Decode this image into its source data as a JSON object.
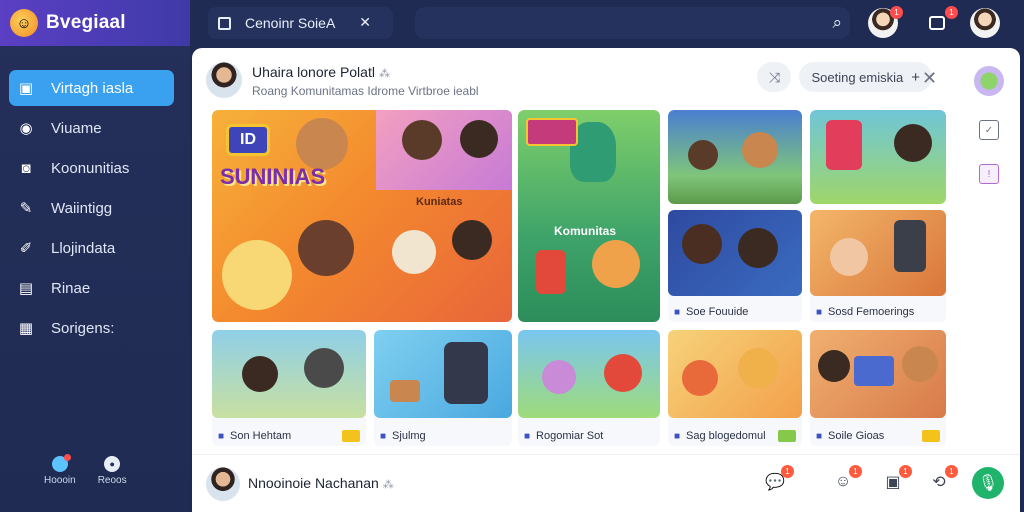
{
  "app": {
    "name": "Bvegiaal",
    "logo_icon": "smiley-logo-icon"
  },
  "sidebar": {
    "items": [
      {
        "label": "Virtagh iasla",
        "icon": "window-icon",
        "active": true
      },
      {
        "label": "Viuame",
        "icon": "chat-bubble-icon"
      },
      {
        "label": "Koonunitias",
        "icon": "camera-icon"
      },
      {
        "label": "Waiintigg",
        "icon": "pencil-icon"
      },
      {
        "label": "Llojindata",
        "icon": "pen-icon"
      },
      {
        "label": "Rinae",
        "icon": "folder-icon"
      },
      {
        "label": "Sorigens:",
        "icon": "grid-icon"
      }
    ],
    "footer": [
      {
        "label": "Hoooin"
      },
      {
        "label": "Reoos"
      }
    ]
  },
  "topbar": {
    "tab_label": "Cenoinr SoieA",
    "notifications_badge": "1",
    "messages_badge": "1"
  },
  "post": {
    "title": "Uhaira lonore Polatl",
    "title_suffix": "⁂",
    "subtitle": "Roang Komunitamas Idrome Virtbroe ieabl",
    "action_button": "Soeting emiskia",
    "plus": "+",
    "close": "✕"
  },
  "cards": {
    "hero_title_1": "SUNINIAS",
    "hero_badge": "ID",
    "hero_kuniatas": "Kuniatas",
    "green_title": "Komunitas",
    "captions": [
      "Soe Fouuide",
      "Sosd Femoerings",
      "Son Hehtam",
      "Sjulmg",
      "Rogomiar Sot",
      "Sag blogedomul",
      "Soile Gioas"
    ]
  },
  "bottom": {
    "name": "Nnooinoie Nachanan",
    "name_suffix": "⁂",
    "badges": [
      "1",
      "1",
      "1",
      "1"
    ]
  },
  "colors": {
    "sidebar_bg": "#24305a",
    "brand_bar": "#5b3fc4",
    "active_nav": "#3aa0f0",
    "accent_green": "#1fb36b",
    "badge_red": "#ff4d4d"
  }
}
